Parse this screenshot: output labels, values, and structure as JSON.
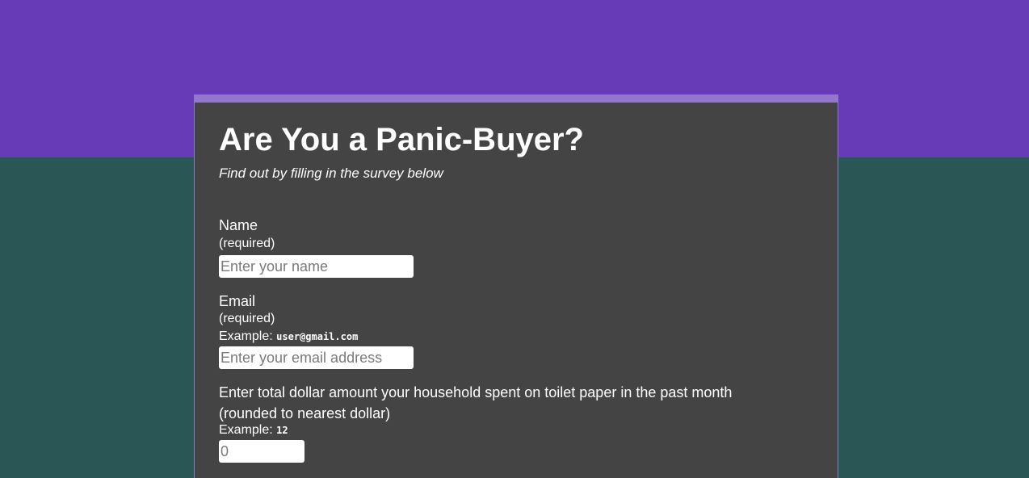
{
  "survey": {
    "title": "Are You a Panic-Buyer?",
    "description": "Find out by filling in the survey below",
    "name_field": {
      "label": "Name",
      "required_note": "(required)",
      "placeholder": "Enter your name",
      "value": ""
    },
    "email_field": {
      "label": "Email",
      "required_note": "(required)",
      "example_label": "Example:",
      "example_value": "user@gmail.com",
      "placeholder": "Enter your email address",
      "value": ""
    },
    "amount_field": {
      "label_line1": "Enter total dollar amount your household spent on toilet paper in the past month",
      "label_line2": "(rounded to nearest dollar)",
      "example_label": "Example:",
      "example_value": "12",
      "placeholder": "0",
      "value": ""
    }
  },
  "colors": {
    "header_band": "#673ab7",
    "page_background": "#2b5656",
    "card_background": "#444444",
    "card_accent": "#9575cd"
  }
}
